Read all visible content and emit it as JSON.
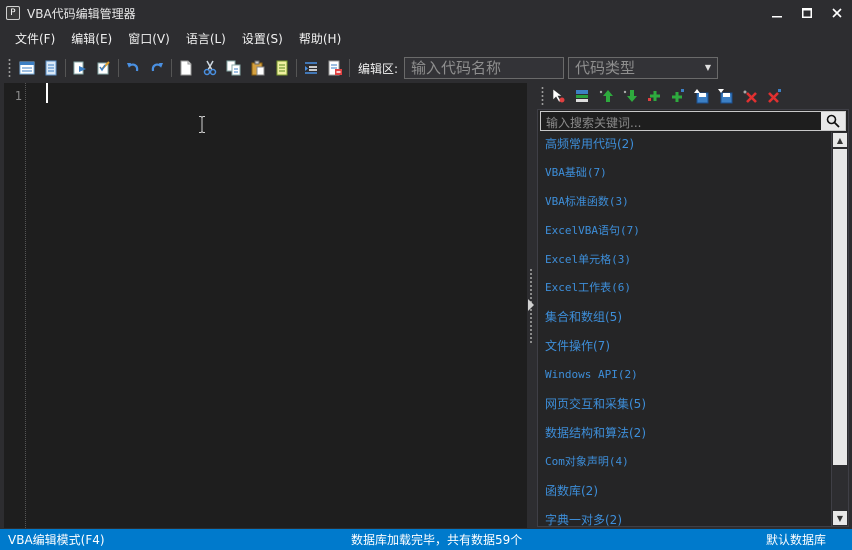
{
  "window": {
    "icon_text": "P",
    "title": "VBA代码编辑管理器"
  },
  "menu": [
    {
      "label": "文件(F)"
    },
    {
      "label": "编辑(E)"
    },
    {
      "label": "窗口(V)"
    },
    {
      "label": "语言(L)"
    },
    {
      "label": "设置(S)"
    },
    {
      "label": "帮助(H)"
    }
  ],
  "toolbar": {
    "edit_area_label": "编辑区:",
    "code_name_placeholder": "输入代码名称",
    "code_type_placeholder": "代码类型",
    "icons": [
      "window-icon",
      "document-icon",
      "preview-icon",
      "edit-check-icon",
      "undo-icon",
      "redo-icon",
      "new-file-icon",
      "cut-icon",
      "copy-icon",
      "paste-icon",
      "notes-icon",
      "indent-icon",
      "export-icon"
    ]
  },
  "editor": {
    "line_numbers": [
      "1"
    ]
  },
  "panel": {
    "toolbar_icons": [
      "select-icon",
      "collapse-icon",
      "move-up-icon",
      "move-down-icon",
      "add-group-icon",
      "add-item-icon",
      "save-up-icon",
      "save-down-icon",
      "delete-group-icon",
      "delete-item-icon"
    ],
    "search_placeholder": "输入搜索关键词...",
    "categories": [
      {
        "label": "高频常用代码(2)"
      },
      {
        "label": "VBA基础(7)"
      },
      {
        "label": "VBA标准函数(3)"
      },
      {
        "label": "ExcelVBA语句(7)"
      },
      {
        "label": "Excel单元格(3)"
      },
      {
        "label": "Excel工作表(6)"
      },
      {
        "label": "集合和数组(5)"
      },
      {
        "label": "文件操作(7)"
      },
      {
        "label": "Windows API(2)"
      },
      {
        "label": "网页交互和采集(5)"
      },
      {
        "label": "数据结构和算法(2)"
      },
      {
        "label": "Com对象声明(4)"
      },
      {
        "label": "函数库(2)"
      },
      {
        "label": "字典一对多(2)"
      }
    ]
  },
  "status": {
    "mode": "VBA编辑模式(F4)",
    "message": "数据库加载完毕，共有数据59个",
    "database": "默认数据库"
  },
  "colors": {
    "accent": "#007acc",
    "link": "#3d8ed9",
    "editor_bg": "#1e1e1e",
    "chrome_bg": "#2d2d30"
  }
}
